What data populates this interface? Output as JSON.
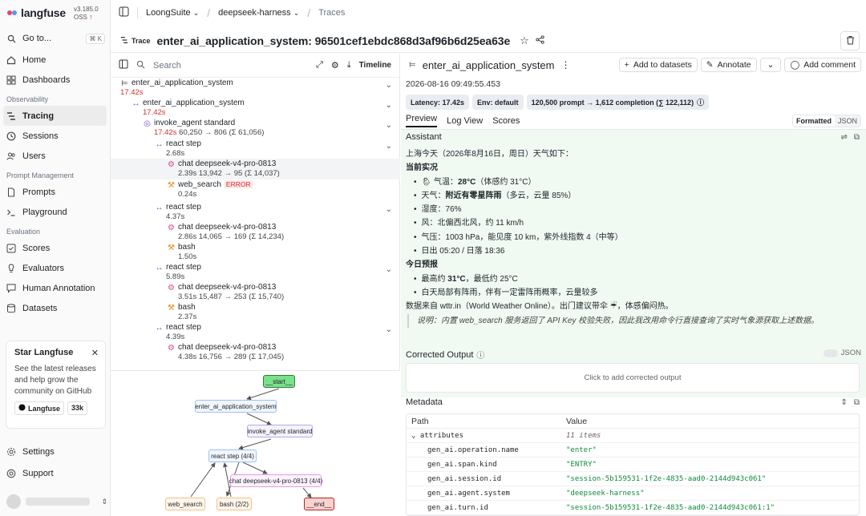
{
  "app": {
    "name": "langfuse",
    "version": "v3.185.0 OSS",
    "goto_label": "Go to...",
    "goto_shortcut": "⌘ K"
  },
  "sidebar": {
    "top_items": [
      {
        "label": "Home",
        "icon": "home-icon"
      },
      {
        "label": "Dashboards",
        "icon": "dashboard-icon"
      }
    ],
    "sections": [
      {
        "label": "Observability",
        "items": [
          {
            "label": "Tracing",
            "icon": "tracing-icon",
            "active": true
          },
          {
            "label": "Sessions",
            "icon": "clock-icon"
          },
          {
            "label": "Users",
            "icon": "users-icon"
          }
        ]
      },
      {
        "label": "Prompt Management",
        "items": [
          {
            "label": "Prompts",
            "icon": "file-icon"
          },
          {
            "label": "Playground",
            "icon": "terminal-icon"
          }
        ]
      },
      {
        "label": "Evaluation",
        "items": [
          {
            "label": "Scores",
            "icon": "check-square-icon"
          },
          {
            "label": "Evaluators",
            "icon": "lightbulb-icon"
          },
          {
            "label": "Human Annotation",
            "icon": "annotation-icon"
          },
          {
            "label": "Datasets",
            "icon": "database-icon"
          }
        ]
      }
    ],
    "star_card": {
      "title": "Star Langfuse",
      "body": "See the latest releases and help grow the community on GitHub",
      "github_label": "Langfuse",
      "count": "33k"
    },
    "settings_label": "Settings",
    "support_label": "Support"
  },
  "topbar": {
    "org": "LoongSuite",
    "project": "deepseek-harness",
    "page": "Traces"
  },
  "trace": {
    "badge": "Trace",
    "title": "enter_ai_application_system: 96501cef1ebdc868d3af96b6d25ea63e"
  },
  "tree": {
    "search_placeholder": "Search",
    "timeline_label": "Timeline",
    "nodes": [
      {
        "name": "enter_ai_application_system",
        "duration": "17.42s",
        "meta": ""
      },
      {
        "name": "enter_ai_application_system",
        "duration": "17.42s",
        "meta": ""
      },
      {
        "name": "invoke_agent standard",
        "duration": "17.42s",
        "meta": "60,250 → 806 (Σ 61,056)"
      },
      {
        "name": "react step",
        "duration": "2.68s",
        "meta": ""
      },
      {
        "name": "chat deepseek-v4-pro-0813",
        "duration": "2.39s",
        "meta": "13,942 → 95 (Σ 14,037)"
      },
      {
        "name": "web_search",
        "duration": "0.24s",
        "meta": "",
        "badge": "ERROR"
      },
      {
        "name": "react step",
        "duration": "4.37s",
        "meta": ""
      },
      {
        "name": "chat deepseek-v4-pro-0813",
        "duration": "2.86s",
        "meta": "14,065 → 169 (Σ 14,234)"
      },
      {
        "name": "bash",
        "duration": "1.50s",
        "meta": ""
      },
      {
        "name": "react step",
        "duration": "5.89s",
        "meta": ""
      },
      {
        "name": "chat deepseek-v4-pro-0813",
        "duration": "3.51s",
        "meta": "15,487 → 253 (Σ 15,740)"
      },
      {
        "name": "bash",
        "duration": "2.37s",
        "meta": ""
      },
      {
        "name": "react step",
        "duration": "4.39s",
        "meta": ""
      },
      {
        "name": "chat deepseek-v4-pro-0813",
        "duration": "4.38s",
        "meta": "16,756 → 289 (Σ 17,045)"
      }
    ]
  },
  "graph": {
    "nodes": {
      "start": "__start__",
      "app": "enter_ai_application_system",
      "agent": "invoke_agent standard",
      "react": "react step (4/4)",
      "chat": "chat deepseek-v4-pro-0813 (4/4)",
      "web": "web_search",
      "bash": "bash (2/2)",
      "end": "__end__"
    }
  },
  "detail": {
    "name": "enter_ai_application_system",
    "add_to_datasets": "Add to datasets",
    "annotate": "Annotate",
    "add_comment": "Add comment",
    "timestamp": "2026-08-16 09:49:55.453",
    "pills": [
      "Latency: 17.42s",
      "Env: default",
      "120,500 prompt → 1,612 completion (∑ 122,112)"
    ],
    "tabs": [
      "Preview",
      "Log View",
      "Scores"
    ],
    "format_on": "Formatted",
    "format_off": "JSON",
    "assistant_label": "Assistant",
    "assistant": {
      "intro": "上海今天（2026年8月16日，周日）天气如下：",
      "current_header": "当前实况",
      "current": [
        {
          "pre": "🌦 气温：",
          "bold": "28°C",
          "post": "（体感约 31°C）"
        },
        {
          "pre": "天气：",
          "bold": "附近有零星阵雨",
          "post": "（多云，云量 85%）"
        },
        {
          "pre": "湿度：76%",
          "bold": "",
          "post": ""
        },
        {
          "pre": "风：北偏西北风，约 11 km/h",
          "bold": "",
          "post": ""
        },
        {
          "pre": "气压：1003 hPa，能见度 10 km，紫外线指数 4（中等）",
          "bold": "",
          "post": ""
        },
        {
          "pre": "日出 05:20 / 日落 18:36",
          "bold": "",
          "post": ""
        }
      ],
      "forecast_header": "今日预报",
      "forecast": [
        {
          "pre": "最高约 ",
          "bold": "31°C",
          "post": "，最低约 25°C"
        },
        {
          "pre": "白天局部有阵雨，伴有一定雷阵雨概率，云量较多",
          "bold": "",
          "post": ""
        }
      ],
      "source": "数据来自 wttr.in（World Weather Online）。出门建议带伞 ☔，体感偏闷热。",
      "note": "说明：内置 web_search 服务返回了 API Key 校验失败，因此我改用命令行直接查询了实时气象源获取上述数据。"
    },
    "corrected_label": "Corrected Output",
    "corrected_json": "JSON",
    "corrected_placeholder": "Click to add corrected output",
    "metadata_label": "Metadata",
    "metadata_headers": {
      "path": "Path",
      "value": "Value"
    },
    "metadata_rows": [
      {
        "key": "attributes",
        "value": "11 items"
      },
      {
        "key": "gen_ai.operation.name",
        "value": "\"enter\""
      },
      {
        "key": "gen_ai.span.kind",
        "value": "\"ENTRY\""
      },
      {
        "key": "gen_ai.session.id",
        "value": "\"session-5b159531-1f2e-4835-aad0-2144d943c061\""
      },
      {
        "key": "gen_ai.agent.system",
        "value": "\"deepseek-harness\""
      },
      {
        "key": "gen_ai.turn.id",
        "value": "\"session-5b159531-1f2e-4835-aad0-2144d943c061:1\""
      }
    ]
  },
  "colors": {
    "error": "#d32f2f",
    "assistant_bg": "#f0faf3",
    "json_value": "#0f8a3a"
  }
}
